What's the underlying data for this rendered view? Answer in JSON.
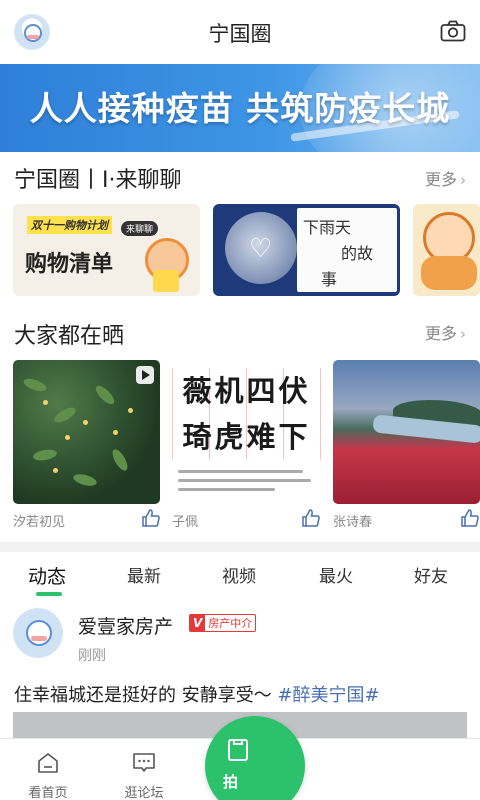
{
  "header": {
    "title": "宁国圈",
    "avatar_icon": "user-avatar-icon",
    "camera_icon": "camera-icon"
  },
  "banner": {
    "text": "人人接种疫苗 共筑防疫长城"
  },
  "topics_section": {
    "title": "宁国圈丨I·来聊聊",
    "more": "更多",
    "cards": [
      {
        "tag": "双十一购物计划",
        "tag2": "来聊聊",
        "headline": "购物清单"
      },
      {
        "line1": "下雨天",
        "line2": "的故",
        "line3": "事"
      },
      {
        "name": "cartoon-kid-card"
      }
    ]
  },
  "photos_section": {
    "title": "大家都在晒",
    "more": "更多",
    "items": [
      {
        "author": "汐若初见",
        "type": "video"
      },
      {
        "author": "子佩",
        "chars_row1": "薇机四伏",
        "chars_row2": "琦虎难下"
      },
      {
        "author": "张诗春"
      }
    ]
  },
  "feed_tabs": [
    "动态",
    "最新",
    "视频",
    "最火",
    "好友"
  ],
  "active_tab": 0,
  "post": {
    "author": "爱壹家房产",
    "badge_v": "V",
    "badge_text": "房产中介",
    "time": "刚刚",
    "text": "住幸福城还是挺好的 安静享受～ ",
    "hashtag": "#醉美宁国#"
  },
  "bottom_nav": {
    "items": [
      {
        "label": "看首页",
        "icon": "home-icon"
      },
      {
        "label": "逛论坛",
        "icon": "forum-icon"
      }
    ],
    "fab_label": "拍",
    "fab_icon": "camera-post-icon"
  },
  "colors": {
    "accent": "#2bc26b",
    "banner": "#3e95e6",
    "hashtag": "#4a6fb0",
    "badge": "#e23a3a"
  }
}
